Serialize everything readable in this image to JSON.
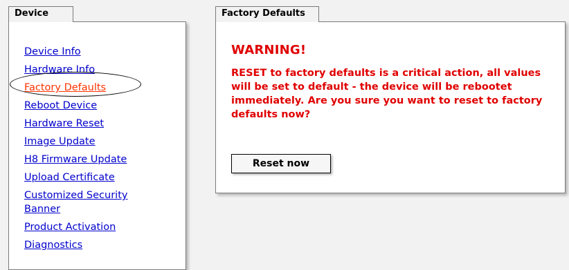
{
  "left_panel": {
    "tab_label": "Device",
    "items": [
      {
        "label": "Device Info",
        "active": false
      },
      {
        "label": "Hardware Info",
        "active": false
      },
      {
        "label": "Factory Defaults",
        "active": true
      },
      {
        "label": "Reboot Device",
        "active": false
      },
      {
        "label": "Hardware Reset",
        "active": false
      },
      {
        "label": "Image Update",
        "active": false
      },
      {
        "label": "H8 Firmware Update",
        "active": false
      },
      {
        "label": "Upload Certificate",
        "active": false
      },
      {
        "label": "Customized Security Banner",
        "active": false
      },
      {
        "label": "Product Activation",
        "active": false
      },
      {
        "label": "Diagnostics",
        "active": false
      }
    ]
  },
  "right_panel": {
    "tab_label": "Factory Defaults",
    "warning_title": "WARNING!",
    "warning_text": "RESET to factory defaults is a critical action, all values will be set to default - the device will be rebootet immediately. Are you sure you want to reset to factory defaults now?",
    "button_label": "Reset now"
  },
  "colors": {
    "link": "#0000cc",
    "active_link": "#ff3300",
    "warning": "#e00000",
    "background": "#f2f2f2"
  }
}
